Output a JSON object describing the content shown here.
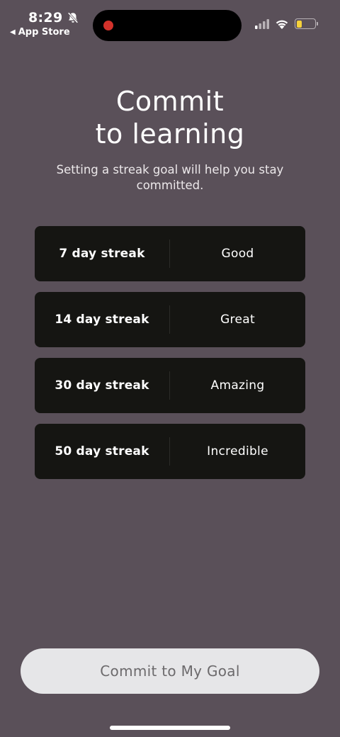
{
  "status_bar": {
    "time": "8:29",
    "back_label": "App Store",
    "back_arrow": "◀",
    "icons": [
      "bell-slash-icon",
      "cellular-signal-icon",
      "wifi-icon",
      "battery-icon"
    ],
    "battery_level": 0.3,
    "battery_color": "#f6d23a",
    "recording_color": "#d3322b"
  },
  "header": {
    "title": "Commit\nto learning",
    "subtitle": "Setting a streak goal will help you stay committed."
  },
  "options": [
    {
      "days": "7 day streak",
      "rating": "Good"
    },
    {
      "days": "14 day streak",
      "rating": "Great"
    },
    {
      "days": "30 day streak",
      "rating": "Amazing"
    },
    {
      "days": "50 day streak",
      "rating": "Incredible"
    }
  ],
  "cta": {
    "label": "Commit to My Goal"
  },
  "colors": {
    "background": "#5a5059",
    "option_card": "#151512",
    "cta_background": "#e6e6e8",
    "cta_text": "#6c6a6c"
  }
}
